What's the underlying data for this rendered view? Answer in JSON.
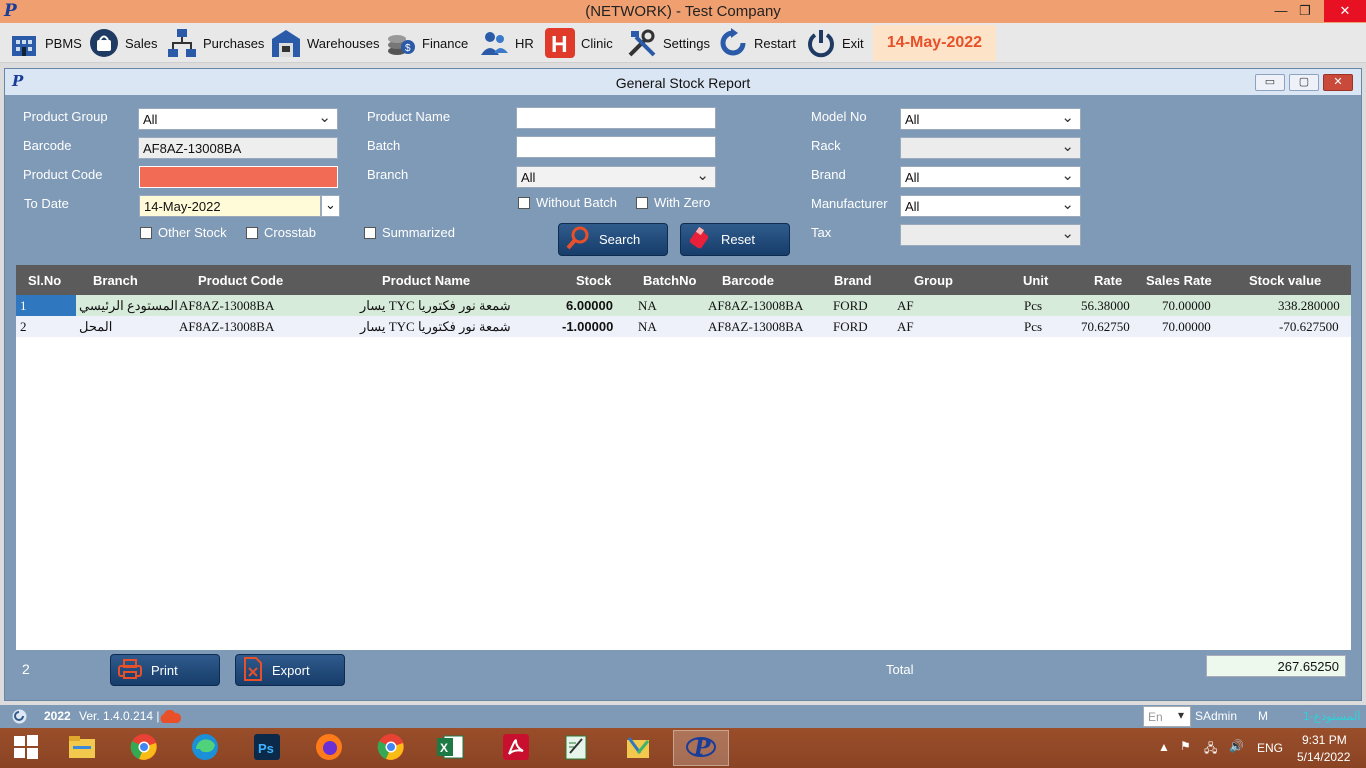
{
  "window": {
    "title": "(NETWORK) - Test Company"
  },
  "menu": {
    "items": [
      "PBMS",
      "Sales",
      "Purchases",
      "Warehouses",
      "Finance",
      "HR",
      "Clinic",
      "Settings",
      "Restart",
      "Exit"
    ],
    "date": "14-May-2022"
  },
  "report": {
    "title": "General Stock Report"
  },
  "form": {
    "product_group_label": "Product Group",
    "product_group_value": "All",
    "barcode_label": "Barcode",
    "barcode_value": "AF8AZ-13008BA",
    "product_code_label": "Product Code",
    "to_date_label": "To Date",
    "to_date_value": "14-May-2022",
    "other_stock_label": "Other Stock",
    "crosstab_label": "Crosstab",
    "summarized_label": "Summarized",
    "product_name_label": "Product Name",
    "batch_label": "Batch",
    "branch_label": "Branch",
    "branch_value": "All",
    "without_batch_label": "Without Batch",
    "with_zero_label": "With Zero",
    "search_label": "Search",
    "reset_label": "Reset",
    "model_no_label": "Model No",
    "model_no_value": "All",
    "rack_label": "Rack",
    "brand_label": "Brand",
    "brand_value": "All",
    "manufacturer_label": "Manufacturer",
    "manufacturer_value": "All",
    "tax_label": "Tax"
  },
  "grid": {
    "columns": [
      "Sl.No",
      "Branch",
      "Product Code",
      "Product Name",
      "Stock",
      "BatchNo",
      "Barcode",
      "Brand",
      "Group",
      "Unit",
      "Rate",
      "Sales Rate",
      "Stock value"
    ],
    "rows": [
      {
        "slno": "1",
        "branch": "المستودع الرئيسي",
        "code": "AF8AZ-13008BA",
        "name": "يسار TYC شمعة نور فكتوريا",
        "stock": "6.00000",
        "batch": "NA",
        "barcode": "AF8AZ-13008BA",
        "brand": "FORD",
        "group": "AF",
        "unit": "Pcs",
        "rate": "56.38000",
        "sales_rate": "70.00000",
        "stock_value": "338.280000"
      },
      {
        "slno": "2",
        "branch": "المحل",
        "code": "AF8AZ-13008BA",
        "name": "يسار TYC شمعة نور فكتوريا",
        "stock": "-1.00000",
        "batch": "NA",
        "barcode": "AF8AZ-13008BA",
        "brand": "FORD",
        "group": "AF",
        "unit": "Pcs",
        "rate": "70.62750",
        "sales_rate": "70.00000",
        "stock_value": "-70.627500"
      }
    ]
  },
  "footer": {
    "count": "2",
    "print_label": "Print",
    "export_label": "Export",
    "total_label": "Total",
    "total_value": "267.65250"
  },
  "status": {
    "year": "2022",
    "version": "Ver. 1.4.0.214 |",
    "lang": "En",
    "user": "SAdmin",
    "m": "M",
    "store": "1-المستودع"
  },
  "taskbar": {
    "apps": [
      "start-icon",
      "file-explorer-icon",
      "chrome-icon",
      "edge-icon",
      "photoshop-icon",
      "firefox-icon",
      "chrome-icon",
      "excel-icon",
      "acrobat-icon",
      "notepad-icon",
      "folder-app-icon",
      "pbms-app-icon"
    ],
    "lang": "ENG",
    "time": "9:31 PM",
    "date": "5/14/2022"
  },
  "colors": {
    "accent": "#f0a070",
    "date_text": "#e8502a",
    "panel": "#7f9ab6",
    "row1": "#d6ebd9",
    "row2": "#eef0fa",
    "selected_cell": "#2f78c0",
    "error_field": "#f26b55"
  }
}
